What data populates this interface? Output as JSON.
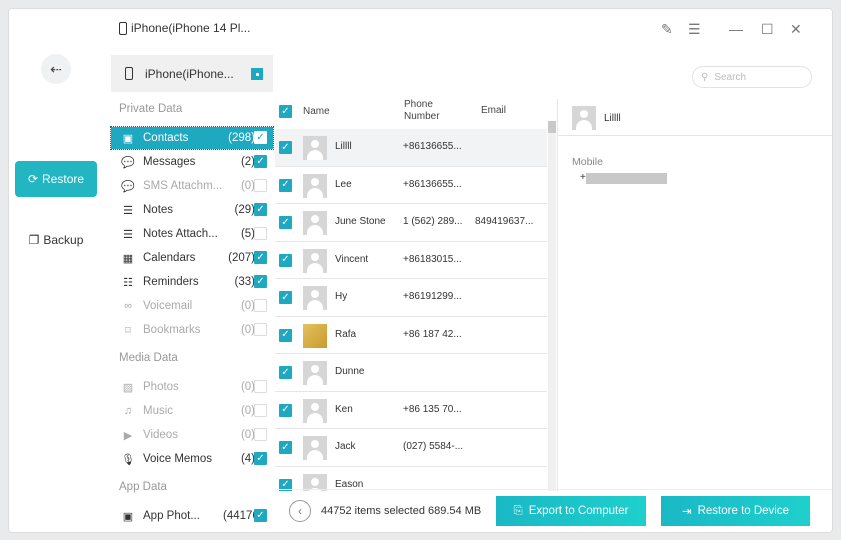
{
  "window": {
    "title": "iPhone(iPhone 14 Pl...",
    "accent": "#1fa9c1"
  },
  "sidebar": {
    "restore": "Restore",
    "backup": "Backup"
  },
  "device": {
    "name": "iPhone(iPhone..."
  },
  "sections": {
    "private": "Private Data",
    "media": "Media Data",
    "app": "App Data"
  },
  "categories": [
    {
      "label": "Contacts",
      "count": "(298)",
      "icon": "contacts-icon",
      "glyph": "▣",
      "state": "selected",
      "checked": true
    },
    {
      "label": "Messages",
      "count": "(2)",
      "icon": "message-icon",
      "glyph": "💬",
      "checked": true
    },
    {
      "label": "SMS Attachm...",
      "count": "(0)",
      "icon": "sms-attachment-icon",
      "glyph": "💬",
      "disabled": true,
      "checked": false
    },
    {
      "label": "Notes",
      "count": "(29)",
      "icon": "notes-icon",
      "glyph": "☰",
      "checked": true
    },
    {
      "label": "Notes Attach...",
      "count": "(5)",
      "icon": "notes-attachment-icon",
      "glyph": "☰",
      "checked": false
    },
    {
      "label": "Calendars",
      "count": "(207)",
      "icon": "calendar-icon",
      "glyph": "▦",
      "checked": true
    },
    {
      "label": "Reminders",
      "count": "(33)",
      "icon": "reminders-icon",
      "glyph": "☷",
      "checked": true
    },
    {
      "label": "Voicemail",
      "count": "(0)",
      "icon": "voicemail-icon",
      "glyph": "∞",
      "disabled": true,
      "checked": false
    },
    {
      "label": "Bookmarks",
      "count": "(0)",
      "icon": "bookmark-icon",
      "glyph": "⌑",
      "disabled": true,
      "checked": false
    },
    {
      "label": "Photos",
      "count": "(0)",
      "icon": "photos-icon",
      "glyph": "▨",
      "disabled": true,
      "checked": false
    },
    {
      "label": "Music",
      "count": "(0)",
      "icon": "music-icon",
      "glyph": "♫",
      "disabled": true,
      "checked": false
    },
    {
      "label": "Videos",
      "count": "(0)",
      "icon": "video-icon",
      "glyph": "▶",
      "disabled": true,
      "checked": false
    },
    {
      "label": "Voice Memos",
      "count": "(4)",
      "icon": "microphone-icon",
      "glyph": "🎙",
      "checked": true
    },
    {
      "label": "App Phot...",
      "count": "(44176)",
      "icon": "app-photo-icon",
      "glyph": "▣",
      "checked": true
    }
  ],
  "table": {
    "headers": {
      "name": "Name",
      "phone": "Phone\nNumber",
      "email": "Email"
    },
    "rows": [
      {
        "name": "Lillll",
        "phone": "+86136655...",
        "email": ""
      },
      {
        "name": "Lee",
        "phone": "+86136655...",
        "email": ""
      },
      {
        "name": "June Stone",
        "phone": "1 (562) 289...",
        "email": "849419637..."
      },
      {
        "name": "Vincent",
        "phone": "+86183015...",
        "email": ""
      },
      {
        "name": "Hy",
        "phone": "+86191299...",
        "email": ""
      },
      {
        "name": "Rafa",
        "phone": "+86 187 42...",
        "email": "",
        "photo": true
      },
      {
        "name": "Dunne",
        "phone": "",
        "email": ""
      },
      {
        "name": "Ken",
        "phone": "+86 135 70...",
        "email": ""
      },
      {
        "name": "Jack",
        "phone": "(027) 5584-...",
        "email": ""
      },
      {
        "name": "Eason",
        "phone": "",
        "email": ""
      }
    ]
  },
  "search": {
    "placeholder": "Search"
  },
  "detail": {
    "name": "Lillll",
    "field_label": "Mobile",
    "field_value": "+"
  },
  "footer": {
    "status": "44752 items selected 689.54 MB",
    "export": "Export to Computer",
    "restore": "Restore to Device"
  }
}
